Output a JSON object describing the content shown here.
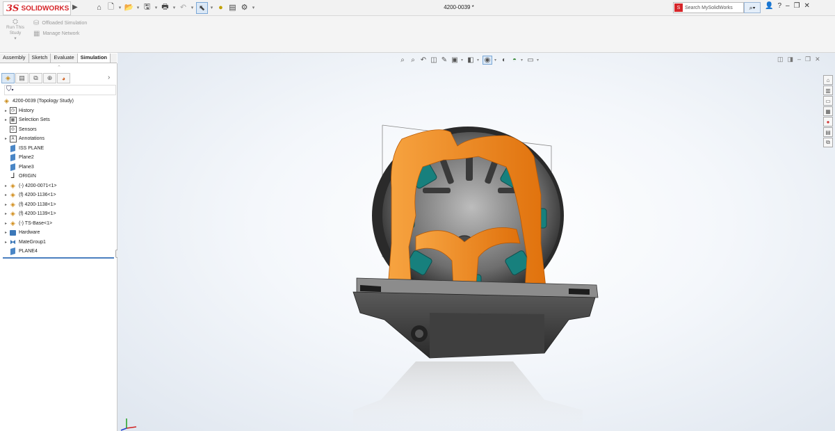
{
  "app": {
    "logo_text": "SOLIDWORKS",
    "logo_prefix": "3S",
    "document_title": "4200-0039 *",
    "search_placeholder": "Search MySolidWorks",
    "window_controls": [
      "?",
      "–",
      "❐",
      "✕"
    ]
  },
  "ribbon": {
    "run_study_line1": "Run This",
    "run_study_line2": "Study",
    "offloaded": "Offloaded Simulation",
    "manage_network": "Manage Network"
  },
  "command_tabs": [
    "Assembly",
    "Sketch",
    "Evaluate",
    "Simulation"
  ],
  "active_tab": "Simulation",
  "tree": {
    "root": "4200-0039  (Topology Study)",
    "items": [
      {
        "label": "History",
        "icon": "history-icon",
        "expandable": true
      },
      {
        "label": "Selection Sets",
        "icon": "selection-sets-icon",
        "expandable": true
      },
      {
        "label": "Sensors",
        "icon": "sensors-icon",
        "expandable": false
      },
      {
        "label": "Annotations",
        "icon": "annotations-icon",
        "expandable": true
      },
      {
        "label": "ISS PLANE",
        "icon": "plane-icon",
        "expandable": false
      },
      {
        "label": "Plane2",
        "icon": "plane-icon",
        "expandable": false
      },
      {
        "label": "Plane3",
        "icon": "plane-icon",
        "expandable": false
      },
      {
        "label": "ORIGIN",
        "icon": "origin-icon",
        "expandable": false
      },
      {
        "label": "(-) 4200-0071<1>",
        "icon": "assembly-icon",
        "expandable": true
      },
      {
        "label": "(f) 4200-1136<1>",
        "icon": "assembly-icon",
        "expandable": true
      },
      {
        "label": "(f) 4200-1138<1>",
        "icon": "assembly-icon",
        "expandable": true
      },
      {
        "label": "(f) 4200-1139<1>",
        "icon": "assembly-icon",
        "expandable": true
      },
      {
        "label": "(-) TS-Base<1>",
        "icon": "assembly-icon",
        "expandable": true
      },
      {
        "label": "Hardware",
        "icon": "folder-icon",
        "expandable": true
      },
      {
        "label": "MateGroup1",
        "icon": "mates-icon",
        "expandable": true
      },
      {
        "label": "PLANE4",
        "icon": "plane-icon",
        "expandable": false
      }
    ]
  },
  "colors": {
    "accent_red": "#d6262a",
    "topology_orange": "#f08a1c",
    "wheel_teal": "#1f8a8a",
    "selection_blue": "#4a7fbf"
  }
}
